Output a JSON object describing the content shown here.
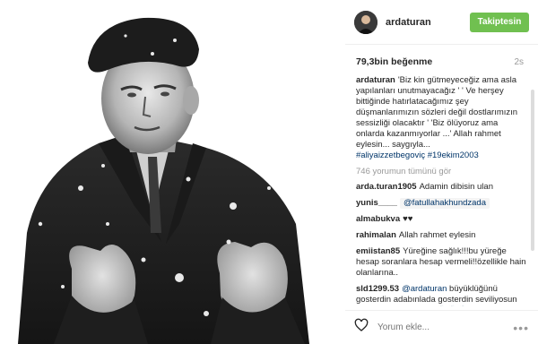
{
  "header": {
    "username": "ardaturan",
    "follow_label": "Takiptesin"
  },
  "meta": {
    "likes": "79,3bin beğenme",
    "time": "2s"
  },
  "caption": {
    "username": "ardaturan",
    "text": "'Biz kin gütmeyeceğiz ama asla yapılanları unutmayacağız ' ' Ve herşey bittiğinde hatırlatacağımız şey düşmanlarımızın sözleri değil dostlarımızın sessizliği olacaktır ' 'Biz ölüyoruz ama onlarda kazanmıyorlar ...' Allah rahmet eylesin... saygıyla...",
    "hashtags": "#aliyaizzetbegoviç #19ekim2003"
  },
  "view_all_comments": "746 yorumun tümünü gör",
  "comments": [
    {
      "user": "arda.turan1905",
      "text": "Adamin dibisin ulan"
    },
    {
      "user": "yunis____",
      "mention": "@fatullahakhundzada",
      "text": ""
    },
    {
      "user": "almabukva",
      "text": "♥♥"
    },
    {
      "user": "rahimalan",
      "text": "Allah rahmet eylesin"
    },
    {
      "user": "emiistan85",
      "text": "Yüreğine sağlık!!!bu yüreğe hesap soranlara hesap vermeli!!özellikle hain olanlarına.."
    },
    {
      "user": "sld1299.53",
      "mention": "@ardaturan",
      "text": "büyüklüğünü gosterdin adabınlada gosterdin seviliyosun koca yurekli adamm 👏🏻👏🏻👏🏻"
    }
  ],
  "footer": {
    "comment_placeholder": "Yorum ekle...",
    "more": "•••"
  },
  "colors": {
    "follow_button": "#70c050",
    "hashtag": "#003569",
    "muted": "#999999"
  },
  "icons": {
    "like": "heart-icon",
    "options": "more-options-icon"
  }
}
